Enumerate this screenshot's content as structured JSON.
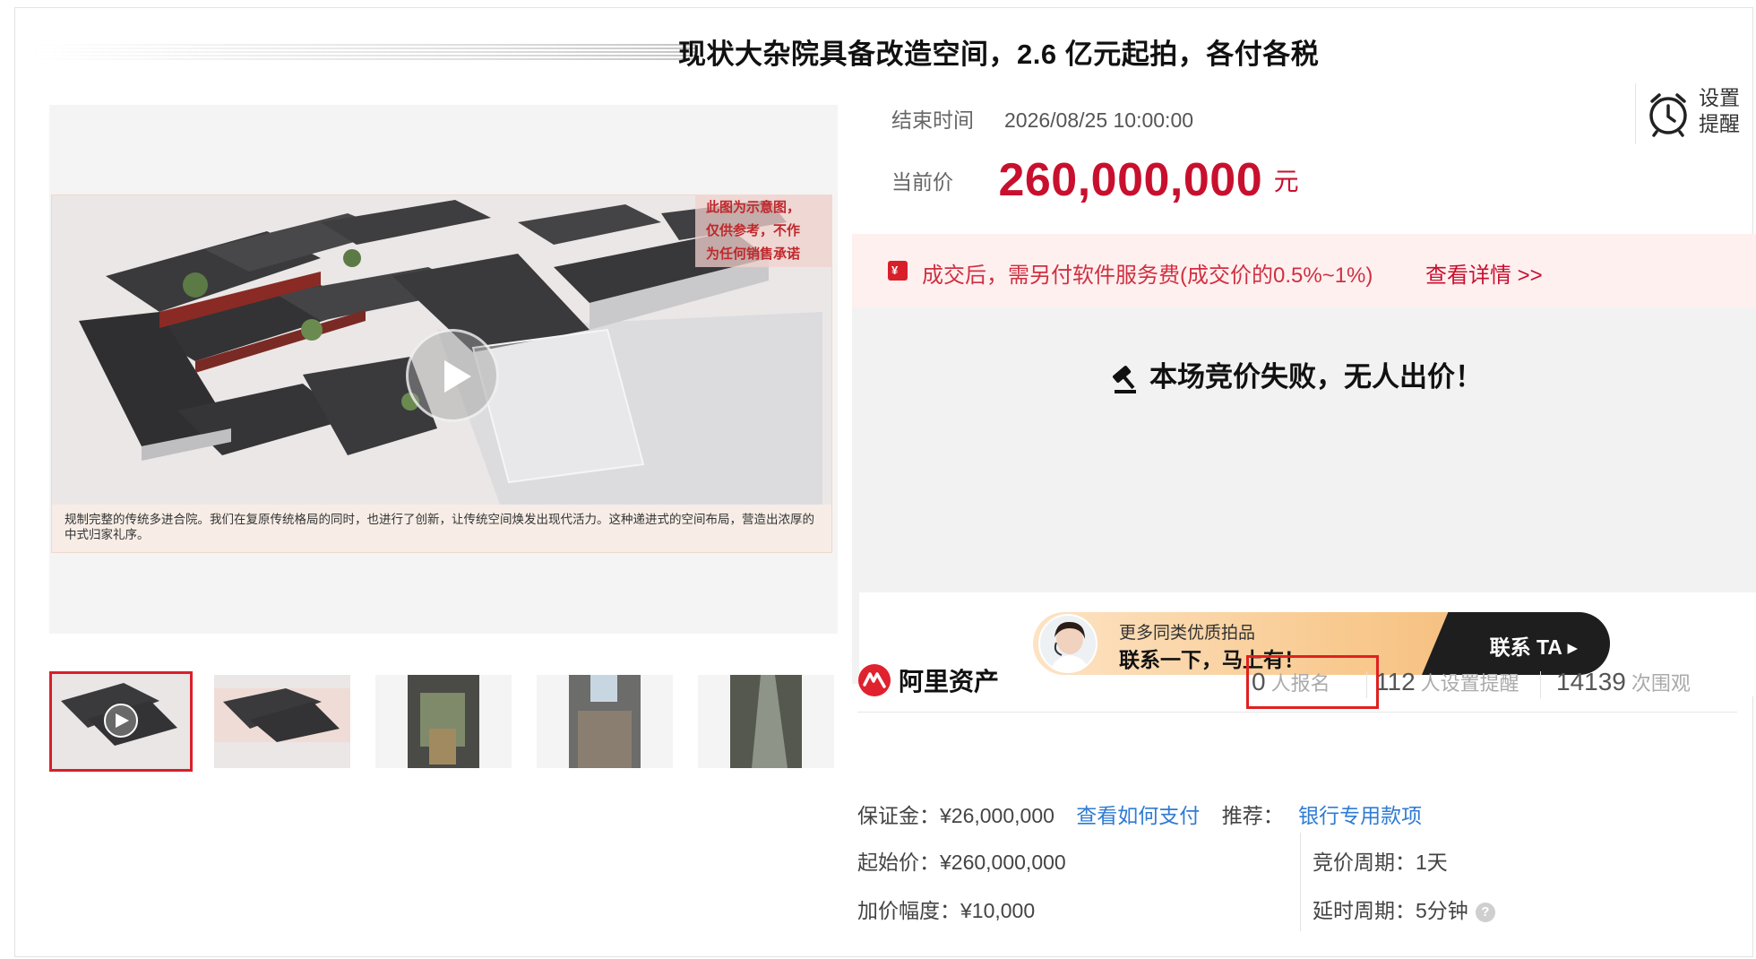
{
  "title": "现状大杂院具备改造空间，2.6 亿元起拍，各付各税",
  "media": {
    "watermark": "此图为示意图，仅供参考，不作为任何销售承诺",
    "caption": "规制完整的传统多进合院。我们在复原传统格局的同时，也进行了创新，让传统空间焕发出现代活力。这种递进式的空间布局，营造出浓厚的中式归家礼序。"
  },
  "auction": {
    "end_label": "结束时间",
    "end_value": "2026/08/25 10:00:00",
    "reminder_label": "设置提醒",
    "price_label": "当前价",
    "price_value": "260,000,000",
    "price_unit": "元",
    "fee_text": "成交后，需另付软件服务费(成交价的0.5%~1%)",
    "fee_link": "查看详情 >>",
    "status_text": "本场竞价失败，无人出价！"
  },
  "promo": {
    "line1": "更多同类优质拍品",
    "line2": "联系一下，马上有！",
    "cta": "联系 TA ▸"
  },
  "stats": {
    "brand": "阿里资产",
    "signups_num": "0",
    "signups_label": "人报名",
    "reminders_num": "112",
    "reminders_label": "人设置提醒",
    "views_num": "14139",
    "views_label": "次围观"
  },
  "info": {
    "deposit": "保证金：¥26,000,000",
    "how_to_pay": "查看如何支付",
    "recommend_label": "推荐：",
    "recommend_link": "银行专用款项",
    "start_price": "起始价：¥260,000,000",
    "cycle": "竞价周期：1天",
    "increment": "加价幅度：¥10,000",
    "delay": "延时周期：5分钟",
    "help": "?"
  },
  "colors": {
    "accent": "#c8102e",
    "link": "#2f7bd4",
    "highlight": "#e02020"
  }
}
